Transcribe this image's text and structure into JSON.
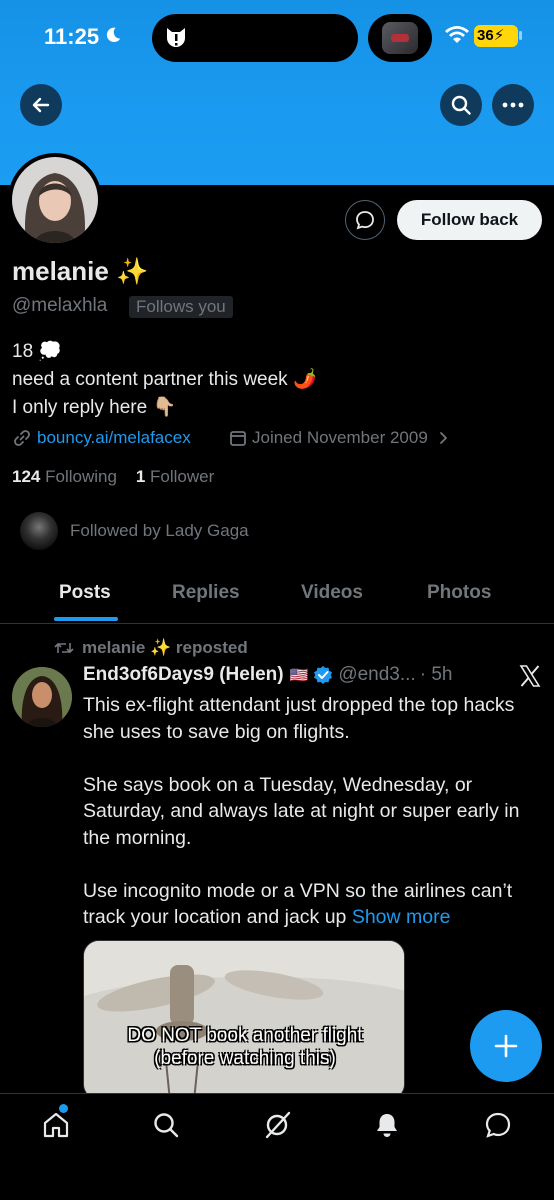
{
  "status_bar": {
    "time": "11:25",
    "battery": "36"
  },
  "profile": {
    "name": "melanie ✨",
    "handle": "@melaxhla",
    "follows_you": "Follows you",
    "follow_back_label": "Follow back",
    "bio_lines": [
      "18 💭",
      "need a content partner this week 🌶️",
      "I only reply here 👇🏼"
    ],
    "link": "bouncy.ai/melafacex",
    "joined": "Joined November 2009",
    "following_count": "124",
    "following_label": "Following",
    "followers_count": "1",
    "followers_label": "Follower",
    "followed_by": "Followed by Lady Gaga"
  },
  "tabs": [
    {
      "label": "Posts",
      "active": true
    },
    {
      "label": "Replies",
      "active": false
    },
    {
      "label": "Videos",
      "active": false
    },
    {
      "label": "Photos",
      "active": false
    }
  ],
  "tweet": {
    "repost_label": "melanie ✨ reposted",
    "display_name": "End3of6Days9 (Helen)",
    "flag": "🇺🇸",
    "handle": "@end3...",
    "time": "· 5h",
    "paragraphs": [
      "This ex-flight attendant just dropped the top hacks she  uses to save big on flights.",
      "She says book on a Tuesday, Wednesday, or Saturday, and always late at night or super early in the morning.",
      "Use incognito mode or a VPN so the airlines can’t track your location and jack up"
    ],
    "show_more": "Show more",
    "media_caption_1": "DO NOT book another flight",
    "media_caption_2": "(before watching this)"
  },
  "colors": {
    "accent": "#1d9bf0",
    "background": "#000000",
    "banner": "#1b9df2",
    "muted": "#71767b"
  },
  "icons": {
    "nav": [
      "home-icon",
      "search-icon",
      "grok-icon",
      "notifications-icon",
      "messages-icon"
    ]
  }
}
